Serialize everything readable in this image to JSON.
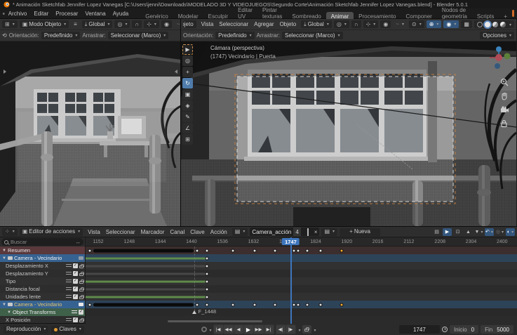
{
  "window": {
    "title": "* Animación Sketchfab Jennifer Lopez Vanegas [C:\\Users\\jenni\\Downloads\\MODELADO 3D Y VIDEOJUEGOS\\Segundo Corte\\Animación Sketchfab Jennifer Lopez Vanegas.blend] - Blender 5.0.1"
  },
  "topbar": {
    "menus": [
      "Archivo",
      "Editar",
      "Procesar",
      "Ventana",
      "Ayuda"
    ],
    "workspaces": [
      "Genérico",
      "Modelar",
      "Esculpir",
      "Editar UV",
      "Pintar texturas",
      "Sombreado",
      "Animar",
      "Procesamiento",
      "Componer",
      "Nodos de geometría",
      "Scripts",
      "+"
    ],
    "active_workspace": "Animar"
  },
  "viewport_left": {
    "mode": "Modo Objeto",
    "transform_orientation": "Global",
    "orientation_label": "Orientación:",
    "orientation_value": "Predefinido",
    "drag_label": "Arrastrar:",
    "drag_value": "Seleccionar (Marco)"
  },
  "viewport_right": {
    "mode": "Modo Objeto",
    "menus": [
      "Vista",
      "Seleccionar",
      "Agregar",
      "Objeto"
    ],
    "transform_orientation": "Global",
    "orientation_label": "Orientación:",
    "orientation_value": "Predefinido",
    "drag_label": "Arrastrar:",
    "drag_value": "Seleccionar (Marco)",
    "options_button": "Opciones",
    "overlay": {
      "line1": "Cámara (perspectiva)",
      "line2": "(1747) Vecindario | Puerta"
    },
    "toolbar": [
      {
        "name": "tweak-select-tool",
        "glyph": "▶",
        "active": false,
        "boxsel": true
      },
      {
        "name": "cursor-tool",
        "glyph": "◎",
        "active": false
      },
      {
        "name": "move-tool",
        "glyph": "+",
        "active": false
      },
      {
        "name": "rotate-tool",
        "glyph": "↻",
        "active": true
      },
      {
        "name": "scale-tool",
        "glyph": "▣",
        "active": false
      },
      {
        "name": "transform-tool",
        "glyph": "◈",
        "active": false
      },
      {
        "name": "annotate-tool",
        "glyph": "✎",
        "active": false
      },
      {
        "name": "measure-tool",
        "glyph": "∠",
        "active": false
      },
      {
        "name": "add-cube-tool",
        "glyph": "⊞",
        "active": false
      }
    ],
    "shading_modes": [
      "wireframe",
      "solid",
      "material",
      "rendered"
    ],
    "active_shading": "solid"
  },
  "dopesheet": {
    "editor_mode": "Editor de acciones",
    "menus": [
      "Vista",
      "Seleccionar",
      "Marcador",
      "Canal",
      "Clave",
      "Acción"
    ],
    "action": {
      "name": "Camera_acción",
      "users": "4"
    },
    "new_action_button": "Nueva",
    "search_placeholder": "Buscar",
    "channels": [
      {
        "name": "Resumen",
        "type": "summary",
        "keys": "train",
        "band": null
      },
      {
        "name": "Camera - Vecindario",
        "type": "group",
        "keys": "single",
        "band": "green"
      },
      {
        "name": "Desplazamiento X",
        "type": "fcurve",
        "keys": "single",
        "band": "gray"
      },
      {
        "name": "Desplazamiento Y",
        "type": "fcurve",
        "keys": "single",
        "band": "gray"
      },
      {
        "name": "Tipo",
        "type": "fcurve",
        "keys": "single",
        "band": "green"
      },
      {
        "name": "Distancia focal",
        "type": "fcurve",
        "keys": "single",
        "band": "gray"
      },
      {
        "name": "Unidades lente",
        "type": "fcurve",
        "keys": "single",
        "band": "green"
      },
      {
        "name": "Camera - Vecindario",
        "type": "group2",
        "keys": "train",
        "band": null
      },
      {
        "name": "Object Transforms",
        "type": "subgroup",
        "keys": null,
        "band": null
      },
      {
        "name": "X Posición",
        "type": "fcurve",
        "keys": null,
        "band": null
      }
    ],
    "ruler_ticks": [
      "1152",
      "1248",
      "1344",
      "1440",
      "1536",
      "1632",
      "1728",
      "1824",
      "1920",
      "2016",
      "2112",
      "2208",
      "2304",
      "2400"
    ],
    "keys": {
      "frame_range": [
        1113,
        2446
      ],
      "summary_frames": [
        1126,
        1458,
        1488,
        1568,
        1635,
        1698,
        1756,
        1769,
        1797,
        1840
      ],
      "selected_frames": [
        1905
      ],
      "hold_bar": [
        1137,
        1447
      ],
      "channel_key_frame": 1488
    },
    "playhead": {
      "frame": 1747,
      "label": "1747"
    },
    "marker": {
      "name": "F_1448",
      "frame": 1448
    }
  },
  "statusbar": {
    "playback_menu": "Reproducción",
    "keying_menu": "Claves",
    "transport": [
      {
        "name": "jump-to-start-button",
        "glyph": "|◀"
      },
      {
        "name": "previous-keyframe-button",
        "glyph": "◀◀"
      },
      {
        "name": "play-reverse-button",
        "glyph": "◀"
      },
      {
        "name": "play-button",
        "glyph": "▶"
      },
      {
        "name": "next-keyframe-button",
        "glyph": "▶▶"
      },
      {
        "name": "jump-to-end-button",
        "glyph": "▶|"
      },
      {
        "name": "step-back-button",
        "glyph": "◀|"
      },
      {
        "name": "step-forward-button",
        "glyph": "|▶"
      }
    ],
    "frame_field": "1747",
    "start_label": "Inicio",
    "start_value": "0",
    "end_label": "Fin",
    "end_value": "5000"
  },
  "colors": {
    "accent_blue": "#3e76bd",
    "selected_key_orange": "#ffaf2e",
    "summary_red": "#5a383c",
    "group_blue": "#366291",
    "subgroup_green": "#3f6049",
    "band_green": "#5f8a4b"
  }
}
